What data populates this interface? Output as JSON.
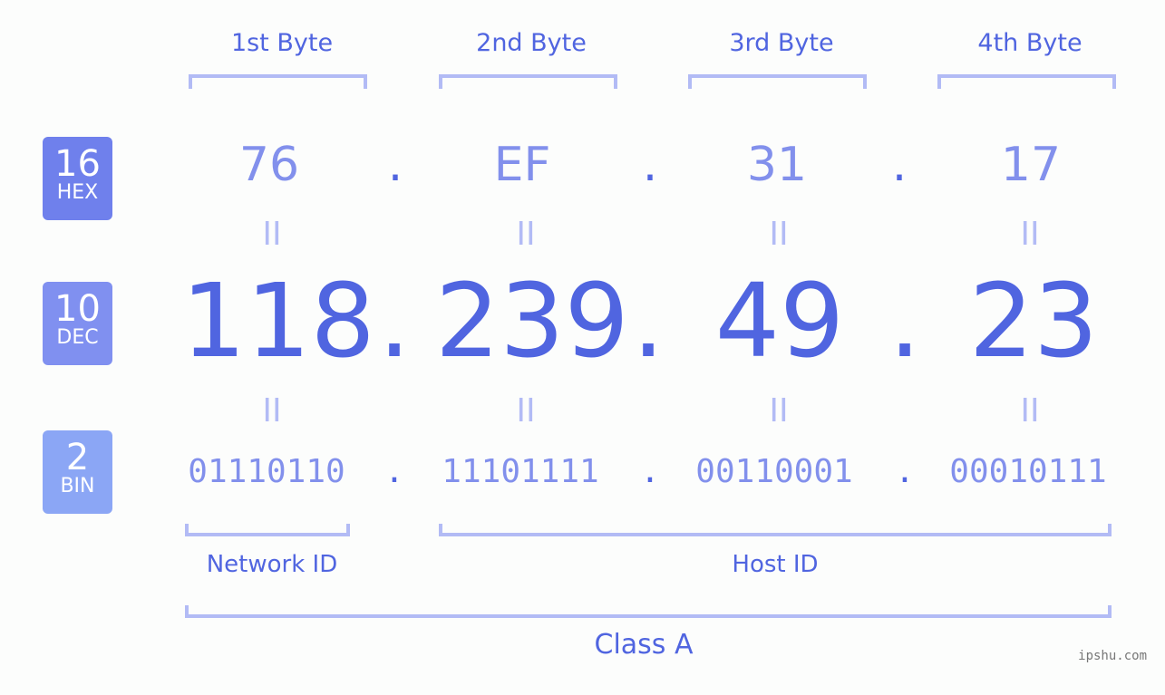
{
  "badges": [
    {
      "num": "16",
      "label": "HEX",
      "color": "#6f80ec"
    },
    {
      "num": "10",
      "label": "DEC",
      "color": "#8090f0"
    },
    {
      "num": "2",
      "label": "BIN",
      "color": "#8ba6f5"
    }
  ],
  "byte_labels": [
    "1st Byte",
    "2nd Byte",
    "3rd Byte",
    "4th Byte"
  ],
  "hex": [
    "76",
    "EF",
    "31",
    "17"
  ],
  "dec": [
    "118",
    "239",
    "49",
    "23"
  ],
  "bin": [
    "01110110",
    "11101111",
    "00110001",
    "00010111"
  ],
  "separator": ".",
  "equals": "II",
  "network_label": "Network ID",
  "host_label": "Host ID",
  "class_label": "Class A",
  "watermark": "ipshu.com"
}
